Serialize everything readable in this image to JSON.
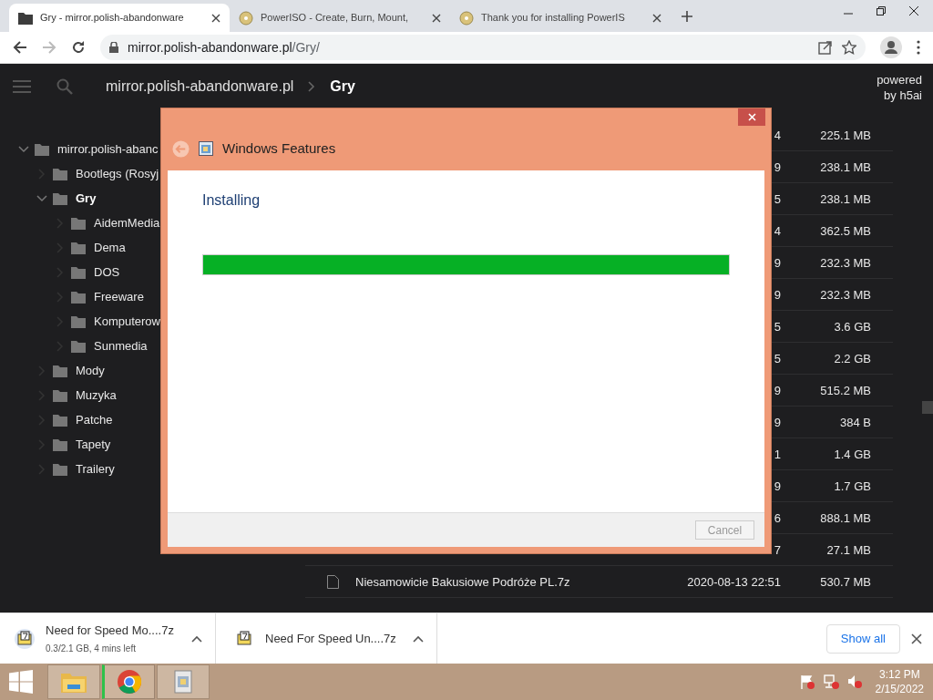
{
  "browser": {
    "tabs": [
      {
        "title": "Gry - mirror.polish-abandonware",
        "selected": true,
        "kind": "folder"
      },
      {
        "title": "PowerISO - Create, Burn, Mount,",
        "selected": false,
        "kind": "disc"
      },
      {
        "title": "Thank you for installing PowerIS",
        "selected": false,
        "kind": "disc"
      }
    ],
    "url": {
      "host": "mirror.polish-abandonware.pl",
      "path": "/Gry/"
    }
  },
  "header": {
    "breadcrumbs": [
      {
        "label": "mirror.polish-abandonware.pl",
        "current": false
      },
      {
        "label": "Gry",
        "current": true
      }
    ],
    "powered_by": [
      "powered",
      "by h5ai"
    ]
  },
  "tree": [
    {
      "label": "mirror.polish-abanc",
      "expanded": true,
      "selected": false,
      "children": [
        {
          "label": "Bootlegs (Rosyj",
          "expanded": false,
          "selected": false
        },
        {
          "label": "Gry",
          "expanded": true,
          "selected": true,
          "children": [
            {
              "label": "AidemMedia",
              "expanded": false,
              "selected": false
            },
            {
              "label": "Dema",
              "expanded": false,
              "selected": false
            },
            {
              "label": "DOS",
              "expanded": false,
              "selected": false
            },
            {
              "label": "Freeware",
              "expanded": false,
              "selected": false
            },
            {
              "label": "Komputerow",
              "expanded": false,
              "selected": false
            },
            {
              "label": "Sunmedia",
              "expanded": false,
              "selected": false
            }
          ]
        },
        {
          "label": "Mody",
          "expanded": false,
          "selected": false
        },
        {
          "label": "Muzyka",
          "expanded": false,
          "selected": false
        },
        {
          "label": "Patche",
          "expanded": false,
          "selected": false
        },
        {
          "label": "Tapety",
          "expanded": false,
          "selected": false
        },
        {
          "label": "Trailery",
          "expanded": false,
          "selected": false
        }
      ]
    }
  ],
  "files": [
    {
      "date": "4",
      "size": "225.1 MB"
    },
    {
      "date": "9",
      "size": "238.1 MB"
    },
    {
      "date": "5",
      "size": "238.1 MB"
    },
    {
      "date": "4",
      "size": "362.5 MB"
    },
    {
      "date": "9",
      "size": "232.3 MB"
    },
    {
      "date": "9",
      "size": "232.3 MB"
    },
    {
      "date": "5",
      "size": "3.6 GB"
    },
    {
      "date": "5",
      "size": "2.2 GB"
    },
    {
      "date": "9",
      "size": "515.2 MB"
    },
    {
      "date": "9",
      "size": "384 B"
    },
    {
      "date": "1",
      "size": "1.4 GB"
    },
    {
      "date": "9",
      "size": "1.7 GB"
    },
    {
      "date": "6",
      "size": "888.1 MB"
    },
    {
      "date": "7",
      "size": "27.1 MB"
    },
    {
      "name": "Niesamowicie Bakusiowe Podróże PL.7z",
      "date": "2020-08-13 22:51",
      "size": "530.7 MB"
    }
  ],
  "dialog": {
    "title": "Windows Features",
    "heading": "Installing",
    "progress": {
      "level": 1
    },
    "cancel": {
      "label": "Cancel",
      "disabled": true
    }
  },
  "downloads": {
    "items": [
      {
        "name": "Need for Speed Mo....7z",
        "status": "0.3/2.1 GB, 4 mins left"
      },
      {
        "name": "Need For Speed Un....7z"
      }
    ],
    "show_all": "Show all"
  },
  "taskbar": {
    "apps": [
      {
        "kind": "explorer",
        "active": false
      },
      {
        "kind": "chrome",
        "active": true
      },
      {
        "kind": "installer",
        "active": false
      }
    ],
    "time": "3:12 PM",
    "date": "2/15/2022"
  }
}
